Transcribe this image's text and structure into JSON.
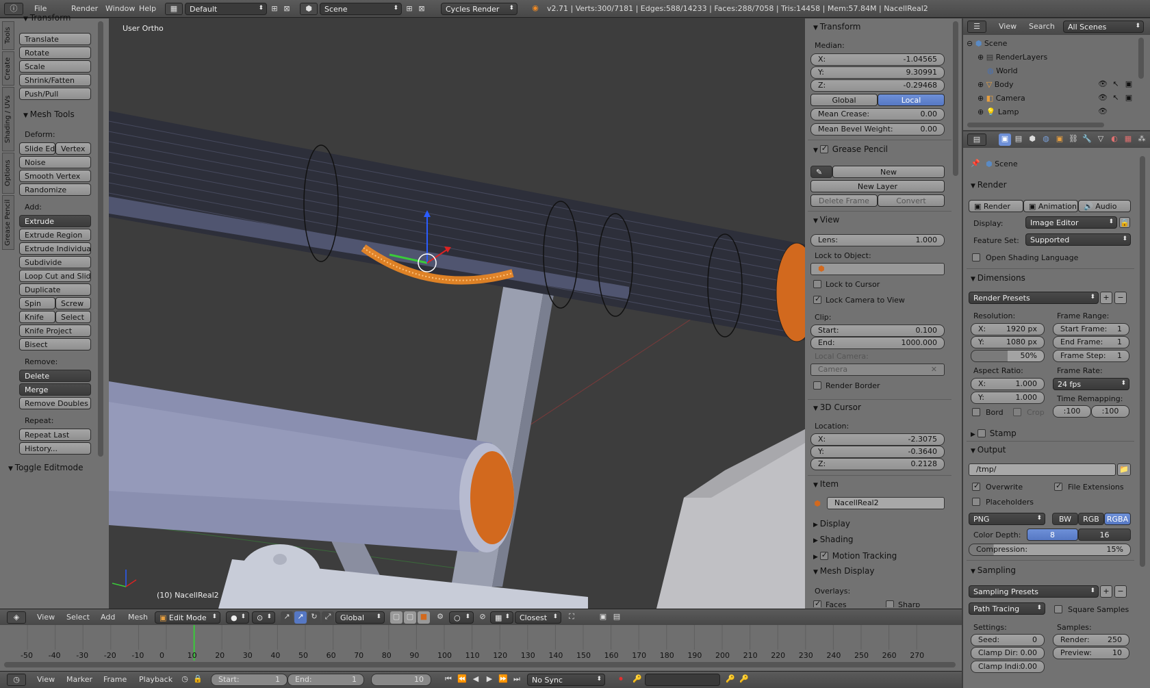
{
  "topbar": {
    "menus": [
      "File",
      "Render",
      "Window",
      "Help"
    ],
    "screen_layout": "Default",
    "scene": "Scene",
    "engine": "Cycles Render",
    "stats": "v2.71 | Verts:300/7181 | Edges:588/14233 | Faces:288/7058 | Tris:14458 | Mem:57.84M | NacellReal2"
  },
  "tools": {
    "sidetabs": [
      "Tools",
      "Create",
      "Shading / UVs",
      "Options",
      "Grease Pencil"
    ],
    "transform_header": "Transform",
    "transform_buttons": [
      "Translate",
      "Rotate",
      "Scale",
      "Shrink/Fatten",
      "Push/Pull"
    ],
    "mesh_tools_header": "Mesh Tools",
    "deform_label": "Deform:",
    "slide_edge": "Slide Ed",
    "vertex": "Vertex",
    "noise": "Noise",
    "smooth_vertex": "Smooth Vertex",
    "randomize": "Randomize",
    "add_label": "Add:",
    "extrude": "Extrude",
    "extrude_region": "Extrude Region",
    "extrude_individual": "Extrude Individual",
    "subdivide": "Subdivide",
    "loop_cut": "Loop Cut and Slide",
    "duplicate": "Duplicate",
    "spin": "Spin",
    "screw": "Screw",
    "knife": "Knife",
    "select": "Select",
    "knife_project": "Knife Project",
    "bisect": "Bisect",
    "remove_label": "Remove:",
    "delete": "Delete",
    "merge": "Merge",
    "remove_doubles": "Remove Doubles",
    "repeat_label": "Repeat:",
    "repeat_last": "Repeat Last",
    "history": "History...",
    "toggle_editmode": "Toggle Editmode"
  },
  "viewport": {
    "view_name": "User Ortho",
    "object_label": "(10) NacellReal2"
  },
  "properties_n": {
    "transform_header": "Transform",
    "median_label": "Median:",
    "x_label": "X:",
    "x": "-1.04565",
    "y_label": "Y:",
    "y": "9.30991",
    "z_label": "Z:",
    "z": "-0.29468",
    "global": "Global",
    "local": "Local",
    "mean_crease_label": "Mean Crease:",
    "mean_crease": "0.00",
    "mean_bevel_label": "Mean Bevel Weight:",
    "mean_bevel": "0.00",
    "grease_pencil_header": "Grease Pencil",
    "new": "New",
    "new_layer": "New Layer",
    "delete_frame": "Delete Frame",
    "convert": "Convert",
    "view_header": "View",
    "lens_label": "Lens:",
    "lens": "1.000",
    "lock_to_object": "Lock to Object:",
    "lock_to_cursor": "Lock to Cursor",
    "lock_camera": "Lock Camera to View",
    "clip_label": "Clip:",
    "start_label": "Start:",
    "clip_start": "0.100",
    "end_label": "End:",
    "clip_end": "1000.000",
    "local_camera": "Local Camera:",
    "camera": "Camera",
    "render_border": "Render Border",
    "cursor_header": "3D Cursor",
    "location_label": "Location:",
    "cx": "-2.3075",
    "cy": "-0.3640",
    "cz": "0.2128",
    "item_header": "Item",
    "item_name": "NacellReal2",
    "display_header": "Display",
    "shading_header": "Shading",
    "motion_tracking_header": "Motion Tracking",
    "mesh_display_header": "Mesh Display",
    "overlays_label": "Overlays:",
    "faces": "Faces",
    "sharp": "Sharp"
  },
  "outliner": {
    "view": "View",
    "search": "Search",
    "filter": "All Scenes",
    "items": [
      "Scene",
      "RenderLayers",
      "World",
      "Body",
      "Camera",
      "Lamp"
    ]
  },
  "render_props": {
    "context": "Scene",
    "render_header": "Render",
    "render_btn": "Render",
    "animation_btn": "Animation",
    "audio_btn": "Audio",
    "display_label": "Display:",
    "display_value": "Image Editor",
    "feature_set_label": "Feature Set:",
    "feature_set_value": "Supported",
    "osl": "Open Shading Language",
    "dimensions_header": "Dimensions",
    "render_presets": "Render Presets",
    "resolution_label": "Resolution:",
    "res_x_label": "X:",
    "res_x": "1920 px",
    "res_y_label": "Y:",
    "res_y": "1080 px",
    "res_pct": "50%",
    "frame_range_label": "Frame Range:",
    "start_frame_label": "Start Frame:",
    "start_frame": "1",
    "end_frame_label": "End Frame:",
    "end_frame": "1",
    "frame_step_label": "Frame Step:",
    "frame_step": "1",
    "aspect_label": "Aspect Ratio:",
    "asp_x": "1.000",
    "asp_y": "1.000",
    "frame_rate_label": "Frame Rate:",
    "frame_rate": "24 fps",
    "time_remap_label": "Time Remapping:",
    "remap_old": ":100",
    "remap_new": ":100",
    "bord": "Bord",
    "crop": "Crop",
    "stamp_header": "Stamp",
    "output_header": "Output",
    "output_path": "/tmp/",
    "overwrite": "Overwrite",
    "file_ext": "File Extensions",
    "placeholders": "Placeholders",
    "format": "PNG",
    "bw": "BW",
    "rgb": "RGB",
    "rgba": "RGBA",
    "color_depth_label": "Color Depth:",
    "depth8": "8",
    "depth16": "16",
    "compression_label": "Compression:",
    "compression": "15%",
    "sampling_header": "Sampling",
    "sampling_presets": "Sampling Presets",
    "path_tracing": "Path Tracing",
    "square_samples": "Square Samples",
    "settings_label": "Settings:",
    "samples_label": "Samples:",
    "seed_label": "Seed:",
    "seed": "0",
    "render_s_label": "Render:",
    "render_s": "250",
    "clamp_dir_label": "Clamp Dir:",
    "clamp_dir": "0.00",
    "preview_label": "Preview:",
    "preview": "10",
    "clamp_ind_label": "Clamp Indi:",
    "clamp_ind": "0.00"
  },
  "view3d_header": {
    "view": "View",
    "select": "Select",
    "add": "Add",
    "mesh": "Mesh",
    "mode": "Edit Mode",
    "orientation": "Global",
    "snap": "Closest"
  },
  "timeline": {
    "ticks": [
      "-50",
      "-40",
      "-30",
      "-20",
      "-10",
      "0",
      "10",
      "20",
      "30",
      "40",
      "50",
      "60",
      "70",
      "80",
      "90",
      "100",
      "110",
      "120",
      "130",
      "140",
      "150",
      "160",
      "170",
      "180",
      "190",
      "200",
      "210",
      "220",
      "230",
      "240",
      "250",
      "260",
      "270"
    ],
    "current_frame_value": 10,
    "view": "View",
    "marker": "Marker",
    "frame": "Frame",
    "playback": "Playback",
    "start_label": "Start:",
    "start": "1",
    "end_label": "End:",
    "end": "1",
    "current": "10",
    "sync": "No Sync"
  },
  "colors": {
    "viewport_bg": "#3d3d3d",
    "panel_bg": "#727272",
    "selection": "#f08a24",
    "accent_blue": "#5678c4"
  }
}
